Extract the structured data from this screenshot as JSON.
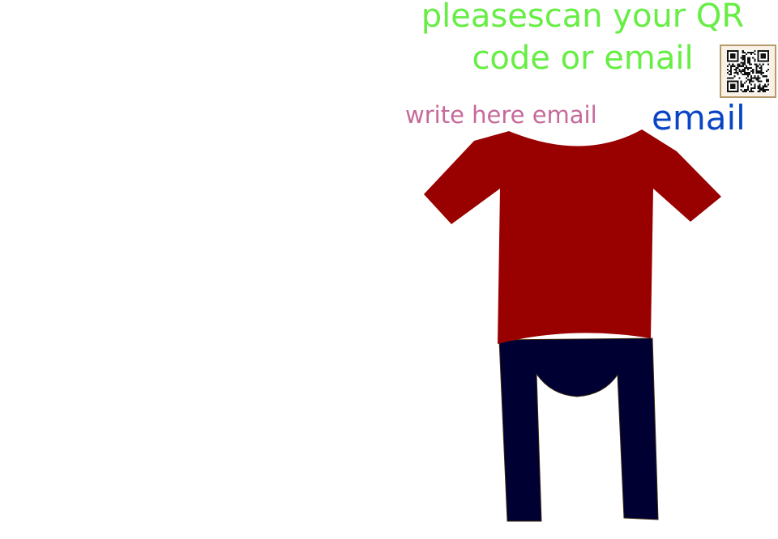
{
  "prompt": {
    "line1": "pleasescan your QR",
    "line2": "code or email",
    "color": "#66ee44"
  },
  "qr_button": {
    "icon": "qr-code-icon"
  },
  "email_input": {
    "value": "",
    "placeholder": "write here email",
    "placeholder_color": "#c6699a"
  },
  "email_button": {
    "label": "email",
    "color": "#0a45c4"
  },
  "clothing": {
    "shirt_color": "#990000",
    "pants_color": "#000033"
  }
}
